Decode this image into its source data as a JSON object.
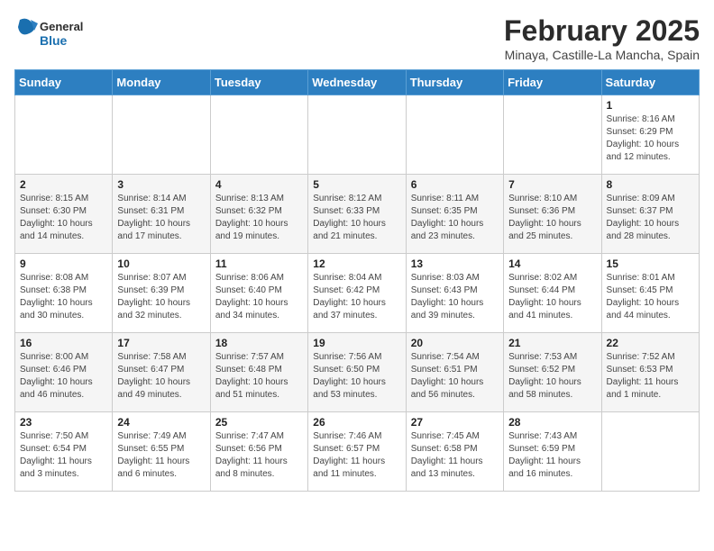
{
  "header": {
    "logo_line1": "General",
    "logo_line2": "Blue",
    "title": "February 2025",
    "subtitle": "Minaya, Castille-La Mancha, Spain"
  },
  "weekdays": [
    "Sunday",
    "Monday",
    "Tuesday",
    "Wednesday",
    "Thursday",
    "Friday",
    "Saturday"
  ],
  "weeks": [
    [
      {
        "day": "",
        "info": ""
      },
      {
        "day": "",
        "info": ""
      },
      {
        "day": "",
        "info": ""
      },
      {
        "day": "",
        "info": ""
      },
      {
        "day": "",
        "info": ""
      },
      {
        "day": "",
        "info": ""
      },
      {
        "day": "1",
        "info": "Sunrise: 8:16 AM\nSunset: 6:29 PM\nDaylight: 10 hours\nand 12 minutes."
      }
    ],
    [
      {
        "day": "2",
        "info": "Sunrise: 8:15 AM\nSunset: 6:30 PM\nDaylight: 10 hours\nand 14 minutes."
      },
      {
        "day": "3",
        "info": "Sunrise: 8:14 AM\nSunset: 6:31 PM\nDaylight: 10 hours\nand 17 minutes."
      },
      {
        "day": "4",
        "info": "Sunrise: 8:13 AM\nSunset: 6:32 PM\nDaylight: 10 hours\nand 19 minutes."
      },
      {
        "day": "5",
        "info": "Sunrise: 8:12 AM\nSunset: 6:33 PM\nDaylight: 10 hours\nand 21 minutes."
      },
      {
        "day": "6",
        "info": "Sunrise: 8:11 AM\nSunset: 6:35 PM\nDaylight: 10 hours\nand 23 minutes."
      },
      {
        "day": "7",
        "info": "Sunrise: 8:10 AM\nSunset: 6:36 PM\nDaylight: 10 hours\nand 25 minutes."
      },
      {
        "day": "8",
        "info": "Sunrise: 8:09 AM\nSunset: 6:37 PM\nDaylight: 10 hours\nand 28 minutes."
      }
    ],
    [
      {
        "day": "9",
        "info": "Sunrise: 8:08 AM\nSunset: 6:38 PM\nDaylight: 10 hours\nand 30 minutes."
      },
      {
        "day": "10",
        "info": "Sunrise: 8:07 AM\nSunset: 6:39 PM\nDaylight: 10 hours\nand 32 minutes."
      },
      {
        "day": "11",
        "info": "Sunrise: 8:06 AM\nSunset: 6:40 PM\nDaylight: 10 hours\nand 34 minutes."
      },
      {
        "day": "12",
        "info": "Sunrise: 8:04 AM\nSunset: 6:42 PM\nDaylight: 10 hours\nand 37 minutes."
      },
      {
        "day": "13",
        "info": "Sunrise: 8:03 AM\nSunset: 6:43 PM\nDaylight: 10 hours\nand 39 minutes."
      },
      {
        "day": "14",
        "info": "Sunrise: 8:02 AM\nSunset: 6:44 PM\nDaylight: 10 hours\nand 41 minutes."
      },
      {
        "day": "15",
        "info": "Sunrise: 8:01 AM\nSunset: 6:45 PM\nDaylight: 10 hours\nand 44 minutes."
      }
    ],
    [
      {
        "day": "16",
        "info": "Sunrise: 8:00 AM\nSunset: 6:46 PM\nDaylight: 10 hours\nand 46 minutes."
      },
      {
        "day": "17",
        "info": "Sunrise: 7:58 AM\nSunset: 6:47 PM\nDaylight: 10 hours\nand 49 minutes."
      },
      {
        "day": "18",
        "info": "Sunrise: 7:57 AM\nSunset: 6:48 PM\nDaylight: 10 hours\nand 51 minutes."
      },
      {
        "day": "19",
        "info": "Sunrise: 7:56 AM\nSunset: 6:50 PM\nDaylight: 10 hours\nand 53 minutes."
      },
      {
        "day": "20",
        "info": "Sunrise: 7:54 AM\nSunset: 6:51 PM\nDaylight: 10 hours\nand 56 minutes."
      },
      {
        "day": "21",
        "info": "Sunrise: 7:53 AM\nSunset: 6:52 PM\nDaylight: 10 hours\nand 58 minutes."
      },
      {
        "day": "22",
        "info": "Sunrise: 7:52 AM\nSunset: 6:53 PM\nDaylight: 11 hours\nand 1 minute."
      }
    ],
    [
      {
        "day": "23",
        "info": "Sunrise: 7:50 AM\nSunset: 6:54 PM\nDaylight: 11 hours\nand 3 minutes."
      },
      {
        "day": "24",
        "info": "Sunrise: 7:49 AM\nSunset: 6:55 PM\nDaylight: 11 hours\nand 6 minutes."
      },
      {
        "day": "25",
        "info": "Sunrise: 7:47 AM\nSunset: 6:56 PM\nDaylight: 11 hours\nand 8 minutes."
      },
      {
        "day": "26",
        "info": "Sunrise: 7:46 AM\nSunset: 6:57 PM\nDaylight: 11 hours\nand 11 minutes."
      },
      {
        "day": "27",
        "info": "Sunrise: 7:45 AM\nSunset: 6:58 PM\nDaylight: 11 hours\nand 13 minutes."
      },
      {
        "day": "28",
        "info": "Sunrise: 7:43 AM\nSunset: 6:59 PM\nDaylight: 11 hours\nand 16 minutes."
      },
      {
        "day": "",
        "info": ""
      }
    ]
  ]
}
